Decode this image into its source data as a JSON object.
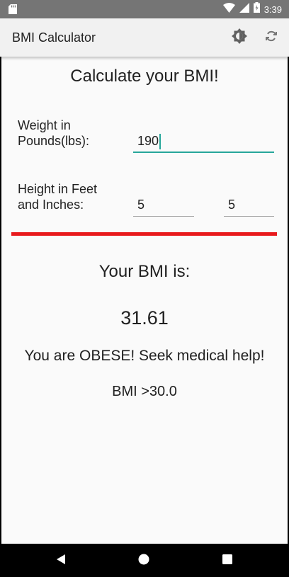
{
  "status_bar": {
    "time": "3:39",
    "icons": [
      "sd-card-icon",
      "wifi-icon",
      "signal-icon",
      "battery-icon"
    ]
  },
  "app_bar": {
    "title": "BMI Calculator",
    "actions": [
      "brightness-icon",
      "refresh-icon"
    ]
  },
  "form": {
    "heading": "Calculate your BMI!",
    "weight_label_line1": "Weight in",
    "weight_label_line2": "Pounds(lbs):",
    "weight_value": "190",
    "height_label_line1": "Height in Feet",
    "height_label_line2": "and Inches:",
    "feet_value": "5",
    "inches_value": "5"
  },
  "result": {
    "title": "Your BMI is:",
    "value": "31.61",
    "message": "You are OBESE! Seek medical help!",
    "range": "BMI >30.0"
  },
  "colors": {
    "accent": "#26a69a",
    "divider": "#e8191c",
    "status_bar": "#757575",
    "app_bar": "#f1f1f1"
  },
  "nav_bar": {
    "buttons": [
      "back-icon",
      "home-icon",
      "recents-icon"
    ]
  }
}
